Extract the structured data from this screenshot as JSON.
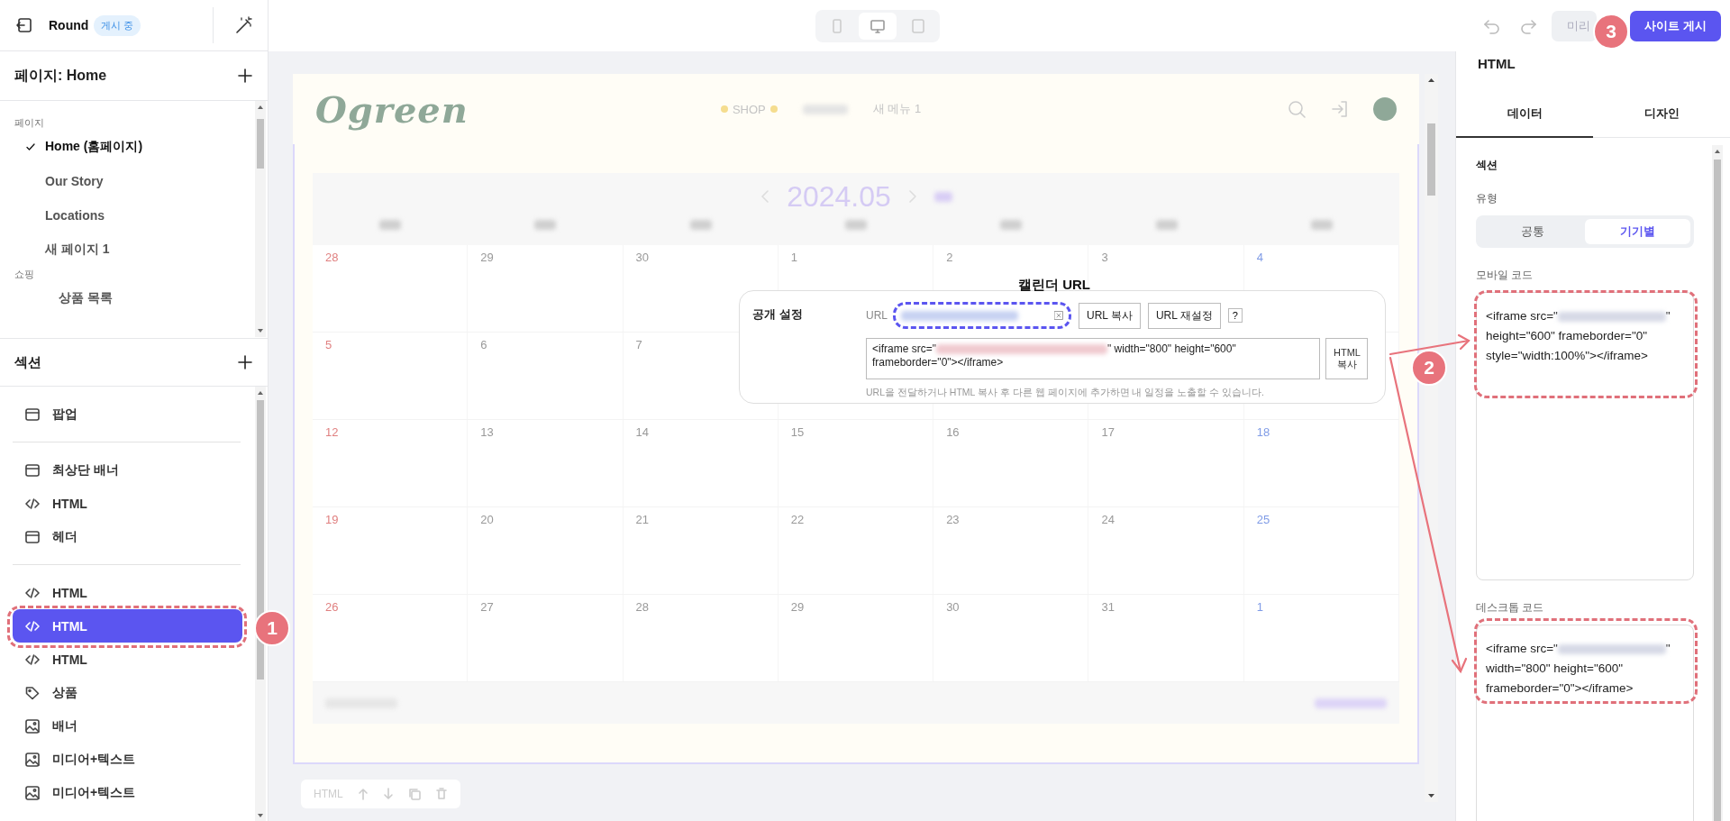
{
  "header": {
    "site_name": "Round",
    "status": "게시 중"
  },
  "pages_panel": {
    "title": "페이지: Home",
    "groups": [
      {
        "label": "페이지",
        "items": [
          {
            "label": "Home (홈페이지)",
            "selected": true
          },
          {
            "label": "Our Story",
            "selected": false
          },
          {
            "label": "Locations",
            "selected": false
          },
          {
            "label": "새 페이지 1",
            "selected": false
          }
        ]
      },
      {
        "label": "쇼핑",
        "items": [
          {
            "label": "상품 목록",
            "selected": false
          }
        ]
      }
    ]
  },
  "sections_panel": {
    "title": "섹션",
    "groups": [
      {
        "items": [
          {
            "kind": "layout",
            "label": "팝업",
            "selected": false
          }
        ]
      },
      {
        "items": [
          {
            "kind": "layout",
            "label": "최상단 배너",
            "selected": false
          },
          {
            "kind": "code",
            "label": "HTML",
            "selected": false
          },
          {
            "kind": "layout",
            "label": "헤더",
            "selected": false
          }
        ]
      },
      {
        "items": [
          {
            "kind": "code",
            "label": "HTML",
            "selected": false
          },
          {
            "kind": "code",
            "label": "HTML",
            "selected": true
          },
          {
            "kind": "code",
            "label": "HTML",
            "selected": false
          },
          {
            "kind": "tag",
            "label": "상품",
            "selected": false
          },
          {
            "kind": "image",
            "label": "배너",
            "selected": false
          },
          {
            "kind": "image",
            "label": "미디어+텍스트",
            "selected": false
          },
          {
            "kind": "image",
            "label": "미디어+텍스트",
            "selected": false
          }
        ]
      }
    ]
  },
  "toolbar": {
    "devices": [
      {
        "kind": "mobile",
        "selected": false
      },
      {
        "kind": "desktop",
        "selected": true
      },
      {
        "kind": "tablet",
        "selected": false
      }
    ],
    "preview_button": "미리",
    "publish_button": "사이트 게시"
  },
  "preview": {
    "logo": "Ogreen",
    "nav": [
      "SHOP",
      "새 메뉴 1"
    ],
    "month": "2024.05",
    "weeks": [
      [
        "28",
        "29",
        "30",
        "1",
        "2",
        "3",
        "4"
      ],
      [
        "5",
        "6",
        "7"
      ],
      [
        "12",
        "13",
        "14",
        "15",
        "16",
        "17",
        "18"
      ],
      [
        "19",
        "20",
        "21",
        "22",
        "23",
        "24",
        "25"
      ],
      [
        "26",
        "27",
        "28",
        "29",
        "30",
        "31",
        "1"
      ]
    ],
    "section_toolbar_label": "HTML"
  },
  "share_popup": {
    "caption": "캘린더 URL",
    "title": "공개 설정",
    "url_label": "URL",
    "buttons": [
      "URL 복사",
      "URL 재설정",
      "?"
    ],
    "code_before": "<iframe src=\"",
    "code_after": "\" width=\"800\" height=\"600\" frameborder=\"0\"></iframe>",
    "copy_html_button": "HTML 복사",
    "hint": "URL을 전달하거나 HTML 복사 후 다른 웹 페이지에 추가하면 내 일정을 노출할 수 있습니다."
  },
  "inspector": {
    "title": "HTML",
    "tabs": [
      {
        "label": "데이터",
        "selected": true
      },
      {
        "label": "디자인",
        "selected": false
      }
    ],
    "section_label": "섹션",
    "type_label": "유형",
    "type_options": [
      {
        "label": "공통",
        "selected": false
      },
      {
        "label": "기기별",
        "selected": true
      }
    ],
    "fields": [
      {
        "label": "모바일 코드",
        "code_before": "<iframe src=\"",
        "code_after": "\" height=\"600\" frameborder=\"0\" style=\"width:100%\"></iframe>"
      },
      {
        "label": "데스크톱 코드",
        "code_before": "<iframe src=\"",
        "code_after": "\" width=\"800\" height=\"600\" frameborder=\"0\"></iframe>"
      }
    ]
  },
  "annotations": [
    "1",
    "2",
    "3"
  ]
}
